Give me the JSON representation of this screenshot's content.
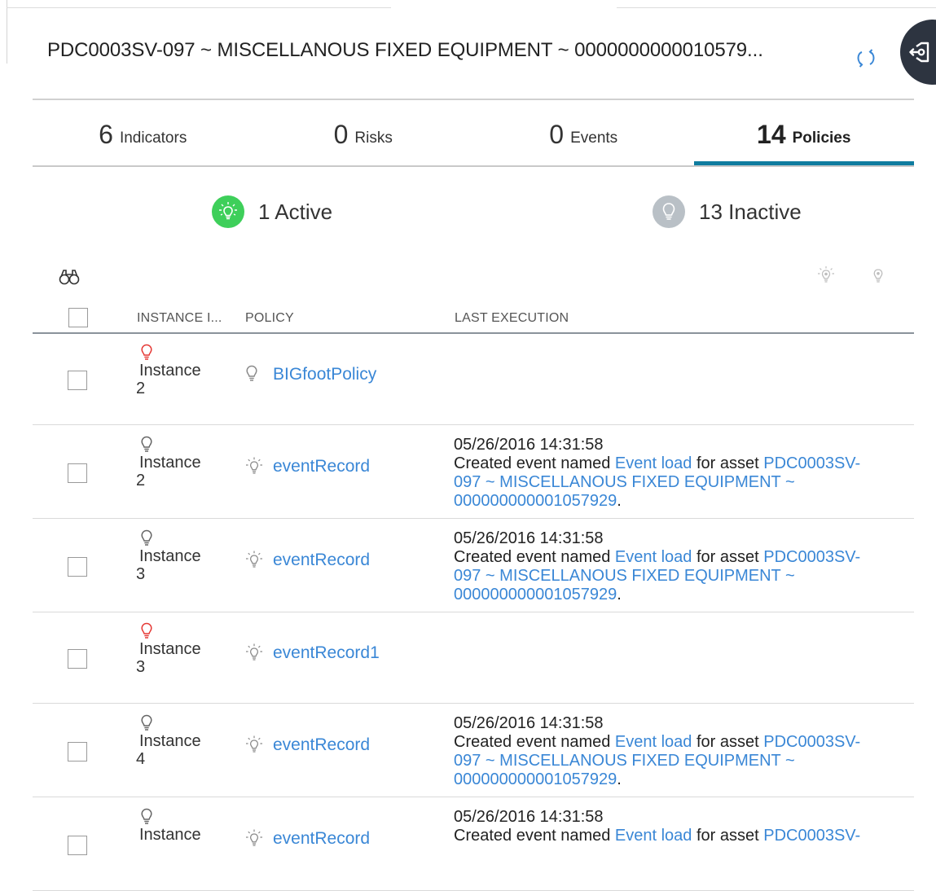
{
  "header": {
    "title": "PDC0003SV-097 ~ MISCELLANOUS FIXED EQUIPMENT ~ 0000000000010579..."
  },
  "tabs": [
    {
      "count": "6",
      "label": "Indicators",
      "active": false
    },
    {
      "count": "0",
      "label": "Risks",
      "active": false
    },
    {
      "count": "0",
      "label": "Events",
      "active": false
    },
    {
      "count": "14",
      "label": "Policies",
      "active": true
    }
  ],
  "summary": {
    "active_label": "1 Active",
    "inactive_label": "13 Inactive"
  },
  "colors": {
    "accent": "#0f7c9f",
    "link": "#3a87d6",
    "active_green": "#3ecf5a",
    "inactive_grey": "#b9c0c6",
    "alert_red": "#e53935"
  },
  "table": {
    "columns": [
      "INSTANCE I...",
      "POLICY",
      "LAST EXECUTION"
    ],
    "rows": [
      {
        "instance_word": "Instance",
        "instance_num": "2",
        "instance_icon": "bulb-red-icon",
        "policy_icon": "bulb-plain-icon",
        "policy": "BIGfootPolicy",
        "has_exec": false,
        "time": "",
        "text_a": "",
        "event_link": "",
        "text_b": "",
        "asset_link_1": "",
        "asset_link_2": "",
        "asset_link_3": "",
        "text_end": ""
      },
      {
        "instance_word": "Instance",
        "instance_num": "2",
        "instance_icon": "bulb-grey-icon",
        "policy_icon": "bulb-lit-icon",
        "policy": "eventRecord",
        "has_exec": true,
        "time": "05/26/2016 14:31:58",
        "text_a": "Created event named ",
        "event_link": "Event load",
        "text_b": " for asset ",
        "asset_link_1": "PDC0003SV-",
        "asset_link_2": "097 ~ MISCELLANOUS FIXED EQUIPMENT ~",
        "asset_link_3": "000000000001057929",
        "text_end": "."
      },
      {
        "instance_word": "Instance",
        "instance_num": "3",
        "instance_icon": "bulb-grey-icon",
        "policy_icon": "bulb-lit-icon",
        "policy": "eventRecord",
        "has_exec": true,
        "time": "05/26/2016 14:31:58",
        "text_a": "Created event named ",
        "event_link": "Event load",
        "text_b": " for asset ",
        "asset_link_1": "PDC0003SV-",
        "asset_link_2": "097 ~ MISCELLANOUS FIXED EQUIPMENT ~",
        "asset_link_3": "000000000001057929",
        "text_end": "."
      },
      {
        "instance_word": "Instance",
        "instance_num": "3",
        "instance_icon": "bulb-red-icon",
        "policy_icon": "bulb-lit-icon",
        "policy": "eventRecord1",
        "has_exec": false,
        "time": "",
        "text_a": "",
        "event_link": "",
        "text_b": "",
        "asset_link_1": "",
        "asset_link_2": "",
        "asset_link_3": "",
        "text_end": ""
      },
      {
        "instance_word": "Instance",
        "instance_num": "4",
        "instance_icon": "bulb-grey-icon",
        "policy_icon": "bulb-lit-icon",
        "policy": "eventRecord",
        "has_exec": true,
        "time": "05/26/2016 14:31:58",
        "text_a": "Created event named ",
        "event_link": "Event load",
        "text_b": " for asset ",
        "asset_link_1": "PDC0003SV-",
        "asset_link_2": "097 ~ MISCELLANOUS FIXED EQUIPMENT ~",
        "asset_link_3": "000000000001057929",
        "text_end": "."
      },
      {
        "instance_word": "Instance",
        "instance_num": "",
        "instance_icon": "bulb-grey-icon",
        "policy_icon": "bulb-lit-icon",
        "policy": "eventRecord",
        "has_exec": true,
        "time": "05/26/2016 14:31:58",
        "text_a": "Created event named ",
        "event_link": "Event load",
        "text_b": " for asset ",
        "asset_link_1": "PDC0003SV-",
        "asset_link_2": "",
        "asset_link_3": "",
        "text_end": ""
      }
    ]
  }
}
